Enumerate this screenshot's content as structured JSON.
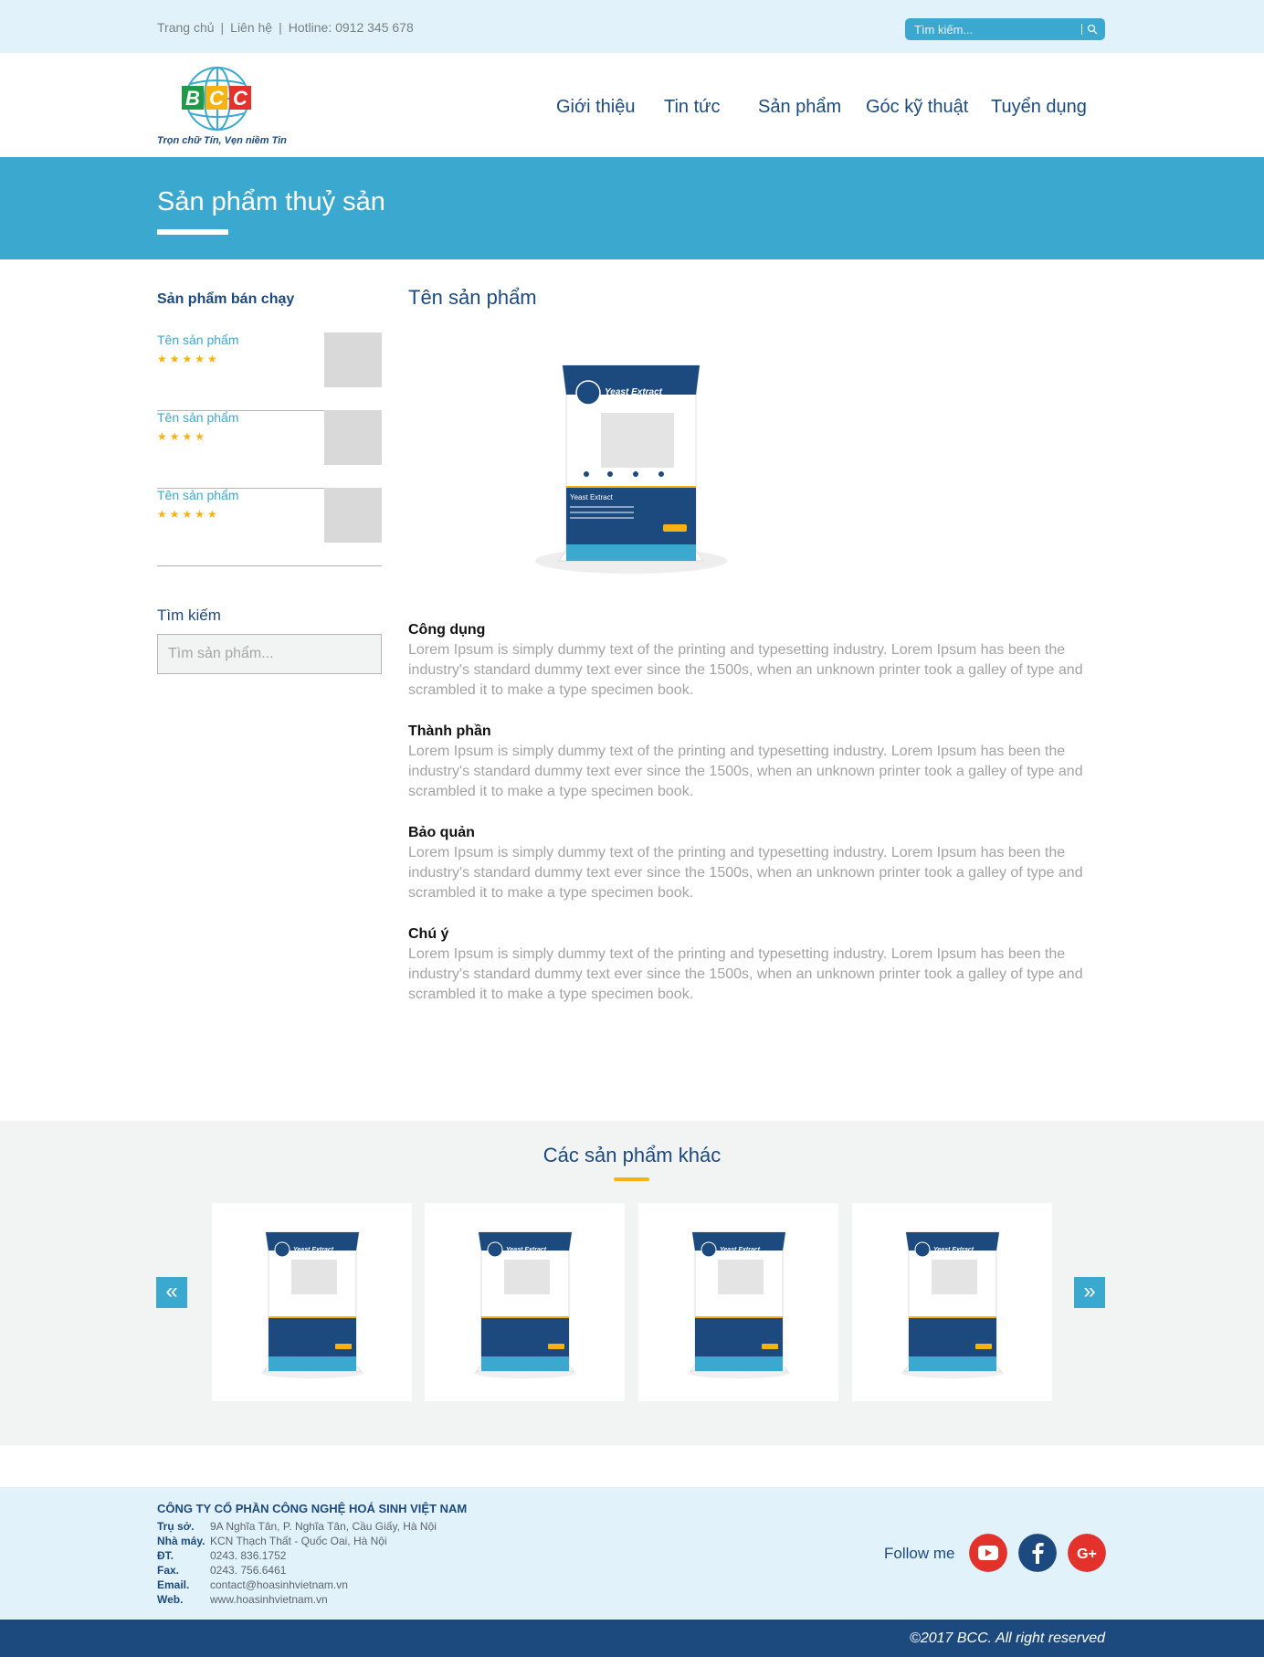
{
  "topbar": {
    "links": [
      "Trang chủ",
      "Liên hệ",
      "Hotline: 0912 345 678"
    ],
    "search_placeholder": "Tìm kiếm..."
  },
  "header": {
    "logo_letters": [
      "B",
      "C",
      "C"
    ],
    "logo_colors": [
      "#1f9a48",
      "#f5b211",
      "#e3322b"
    ],
    "tagline": "Trọn chữ Tín, Vẹn niềm Tin",
    "nav": [
      "Giới thiệu",
      "Tin tức",
      "Sản phẩm",
      "Góc kỹ thuật",
      "Tuyển dụng"
    ]
  },
  "banner": {
    "title": "Sản phẩm thuỷ sản"
  },
  "sidebar": {
    "title": "Sản phẩm bán chạy",
    "items": [
      {
        "name": "Tên sản phẩm",
        "rating": 5
      },
      {
        "name": "Tên sản phẩm",
        "rating": 4
      },
      {
        "name": "Tên sản phẩm",
        "rating": 5
      }
    ],
    "search_label": "Tìm kiếm",
    "search_placeholder": "Tìm sản phẩm..."
  },
  "product": {
    "title": "Tên sản phẩm",
    "package_label": "Yeast Extract",
    "sections": [
      {
        "heading": "Công dụng",
        "text": "Lorem Ipsum is simply dummy text of the printing and typesetting industry. Lorem Ipsum has been the industry's standard dummy text ever since the 1500s, when an unknown printer took a galley of type and scrambled it to make a type specimen book."
      },
      {
        "heading": "Thành phần",
        "text": "Lorem Ipsum is simply dummy text of the printing and typesetting industry. Lorem Ipsum has been the industry's standard dummy text ever since the 1500s, when an unknown printer took a galley of type and scrambled it to make a type specimen book."
      },
      {
        "heading": "Bảo quản",
        "text": "Lorem Ipsum is simply dummy text of the printing and typesetting industry. Lorem Ipsum has been the industry's standard dummy text ever since the 1500s, when an unknown printer took a galley of type and scrambled it to make a type specimen book."
      },
      {
        "heading": "Chú ý",
        "text": "Lorem Ipsum is simply dummy text of the printing and typesetting industry. Lorem Ipsum has been the industry's standard dummy text ever since the 1500s, when an unknown printer took a galley of type and scrambled it to make a type specimen book."
      }
    ]
  },
  "others": {
    "title": "Các sản phẩm khác",
    "prev_label": "«",
    "next_label": "»",
    "card_count": 4
  },
  "footer": {
    "company": "CÔNG TY CỔ PHẦN CÔNG NGHỆ HOÁ SINH VIỆT NAM",
    "rows": [
      {
        "label": "Trụ sở.",
        "value": "9A Nghĩa Tân, P. Nghĩa Tân, Cầu Giấy, Hà Nội"
      },
      {
        "label": "Nhà máy.",
        "value": "KCN Thạch Thất - Quốc Oai, Hà Nội"
      },
      {
        "label": "ĐT.",
        "value": "0243. 836.1752"
      },
      {
        "label": "Fax.",
        "value": "0243. 756.6461"
      },
      {
        "label": "Email.",
        "value": "contact@hoasinhvietnam.vn"
      },
      {
        "label": "Web.",
        "value": "www.hoasinhvietnam.vn"
      }
    ],
    "follow_label": "Follow me",
    "social": [
      {
        "icon": "youtube-icon",
        "color": "#e3322b"
      },
      {
        "icon": "facebook-icon",
        "color": "#1d4a7e"
      },
      {
        "icon": "google-plus-icon",
        "color": "#e3322b"
      }
    ],
    "copyright": "©2017 BCC. All right reserved"
  },
  "colors": {
    "accent": "#3ba8cf",
    "navy": "#1d4a7e",
    "star": "#f5b211",
    "light_bg": "#e1f2fa"
  }
}
